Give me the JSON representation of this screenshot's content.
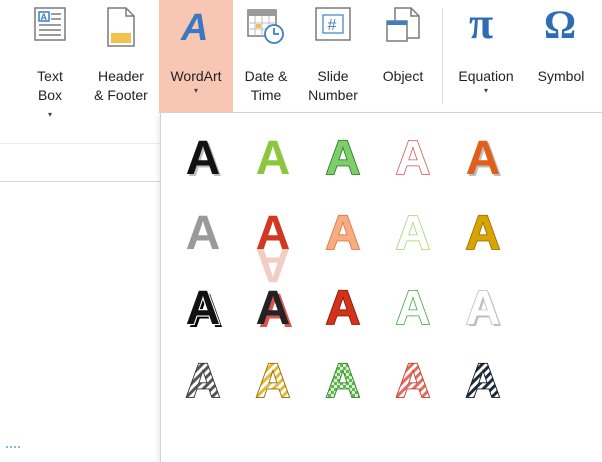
{
  "ribbon": {
    "buttons": [
      {
        "key": "textbox",
        "lines": [
          "Text",
          "Box"
        ],
        "caret_inline": true
      },
      {
        "key": "header",
        "lines": [
          "Header",
          "& Footer"
        ]
      },
      {
        "key": "wordart",
        "lines": [
          "WordArt"
        ],
        "caret_below": true,
        "active": true
      },
      {
        "key": "datetime",
        "lines": [
          "Date &",
          "Time"
        ]
      },
      {
        "key": "slidenum",
        "lines": [
          "Slide",
          "Number"
        ]
      },
      {
        "key": "object",
        "lines": [
          "Object"
        ]
      },
      {
        "key": "equation",
        "lines": [
          "Equation"
        ],
        "caret_below": true
      },
      {
        "key": "symbol",
        "lines": [
          "Symbol"
        ]
      }
    ],
    "icons": {
      "wordart_letter": "A",
      "equation_symbol": "π",
      "symbol_symbol": "Ω",
      "slidenum_symbol": "#"
    }
  },
  "gallery": {
    "glyph": "A",
    "styles": [
      {
        "name": "fill-black-shadow",
        "fill": "#111111",
        "stroke": "none",
        "effect": "shadow"
      },
      {
        "name": "fill-green-accent",
        "fill": "#8cc63f",
        "stroke": "none",
        "effect": "none"
      },
      {
        "name": "fill-green-outline",
        "fill": "#7dcf6a",
        "stroke": "#2f7d2a",
        "effect": "none"
      },
      {
        "name": "outline-red-white",
        "fill": "#ffffff",
        "stroke": "#d9534f",
        "effect": "none"
      },
      {
        "name": "fill-orange-shadow",
        "fill": "#e0601a",
        "stroke": "none",
        "effect": "shadow"
      },
      {
        "name": "fill-gray",
        "fill": "#9a9a9a",
        "stroke": "none",
        "effect": "none"
      },
      {
        "name": "fill-red-reflection",
        "fill": "#d0391f",
        "stroke": "none",
        "effect": "reflection"
      },
      {
        "name": "fill-peach-outline",
        "fill": "#f6ad84",
        "stroke": "#e07b45",
        "effect": "none"
      },
      {
        "name": "outline-lightgreen",
        "fill": "#ffffff",
        "stroke": "#a6d36a",
        "effect": "none"
      },
      {
        "name": "fill-gold",
        "fill": "#d9a400",
        "stroke": "#9a7400",
        "effect": "none"
      },
      {
        "name": "fill-black-white-outline",
        "fill": "#111111",
        "stroke": "#ffffff",
        "effect": "hardshadow"
      },
      {
        "name": "fill-black-red-shadow",
        "fill": "#222222",
        "stroke": "none",
        "effect": "redshadow"
      },
      {
        "name": "fill-red-dark-outline",
        "fill": "#d2311a",
        "stroke": "#8c1a0a",
        "effect": "none"
      },
      {
        "name": "outline-green-white",
        "fill": "#ffffff",
        "stroke": "#3aa635",
        "effect": "none"
      },
      {
        "name": "fill-white-gray-bevel",
        "fill": "#ffffff",
        "stroke": "#bdbdbd",
        "effect": "shadow"
      },
      {
        "name": "pattern-gray-stripes",
        "fill": "stripes:#555555",
        "stroke": "#333333",
        "effect": "none"
      },
      {
        "name": "pattern-gold-stripes",
        "fill": "stripes:#e6b830",
        "stroke": "#8b6b0a",
        "effect": "none"
      },
      {
        "name": "pattern-green-checks",
        "fill": "checks:#5fb84d",
        "stroke": "#2f7d2a",
        "effect": "none"
      },
      {
        "name": "pattern-red-hatch",
        "fill": "stripes:#e36a5a",
        "stroke": "#c0392b",
        "effect": "none"
      },
      {
        "name": "pattern-dark-stripes",
        "fill": "stripes:#1d2a3a",
        "stroke": "#0e1620",
        "effect": "none"
      }
    ]
  }
}
